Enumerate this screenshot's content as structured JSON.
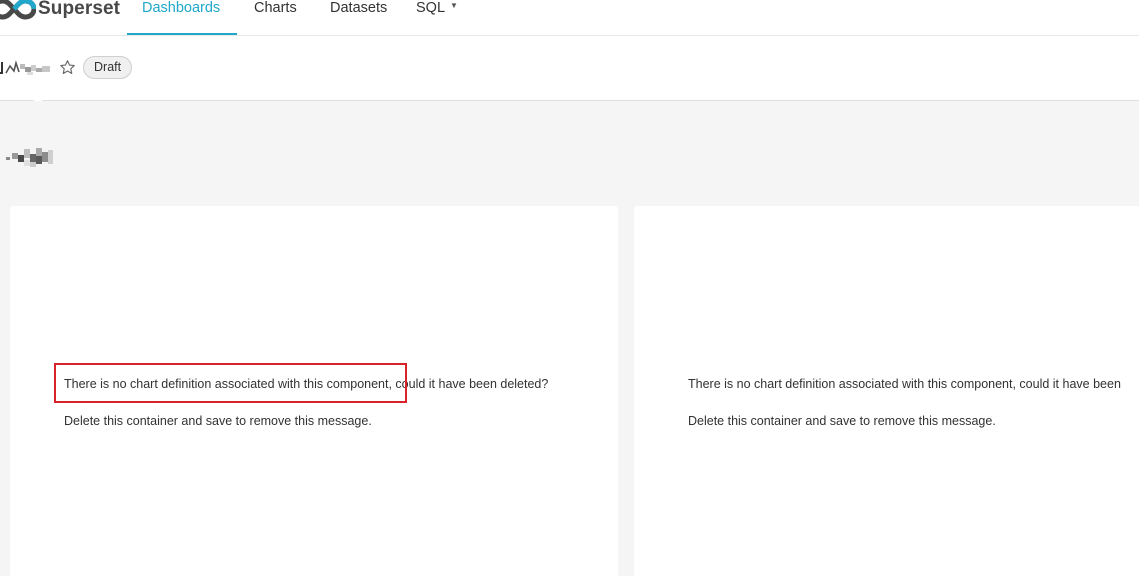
{
  "navbar": {
    "brand": "Superset",
    "items": [
      {
        "label": "Dashboards",
        "active": true
      },
      {
        "label": "Charts",
        "active": false
      },
      {
        "label": "Datasets",
        "active": false
      },
      {
        "label": "SQL",
        "active": false,
        "has_dropdown": true
      }
    ],
    "accent_color": "#20a7c9"
  },
  "dashboard": {
    "title": "[obscured]",
    "status_badge": "Draft",
    "favorite_icon": "star-outline-icon"
  },
  "section": {
    "title": "[obscured]"
  },
  "cards": [
    {
      "message_line1": "There is no chart definition associated with this component, could it have been deleted?",
      "message_line2": "Delete this container and save to remove this message."
    },
    {
      "message_line1": "There is no chart definition associated with this component, could it have been",
      "message_line2": "Delete this container and save to remove this message."
    }
  ],
  "annotation": {
    "highlight_color": "#d8232a"
  }
}
